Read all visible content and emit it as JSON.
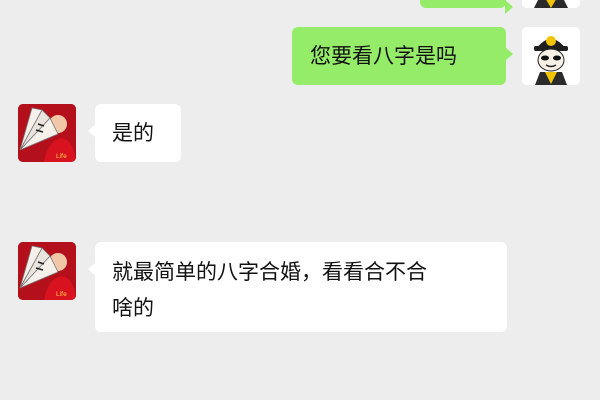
{
  "colors": {
    "background": "#ededed",
    "sent_bubble": "#95ec69",
    "received_bubble": "#ffffff"
  },
  "messages": [
    {
      "sender": "me",
      "text": ""
    },
    {
      "sender": "me",
      "text": "您要看八字是吗"
    },
    {
      "sender": "other",
      "text": "是的"
    },
    {
      "sender": "other",
      "text": "就最简单的八字合婚，看看合不合\n啥的"
    }
  ],
  "avatars": {
    "me": "cartoon-official-avatar-icon",
    "other": "red-fan-portrait-avatar-icon"
  }
}
